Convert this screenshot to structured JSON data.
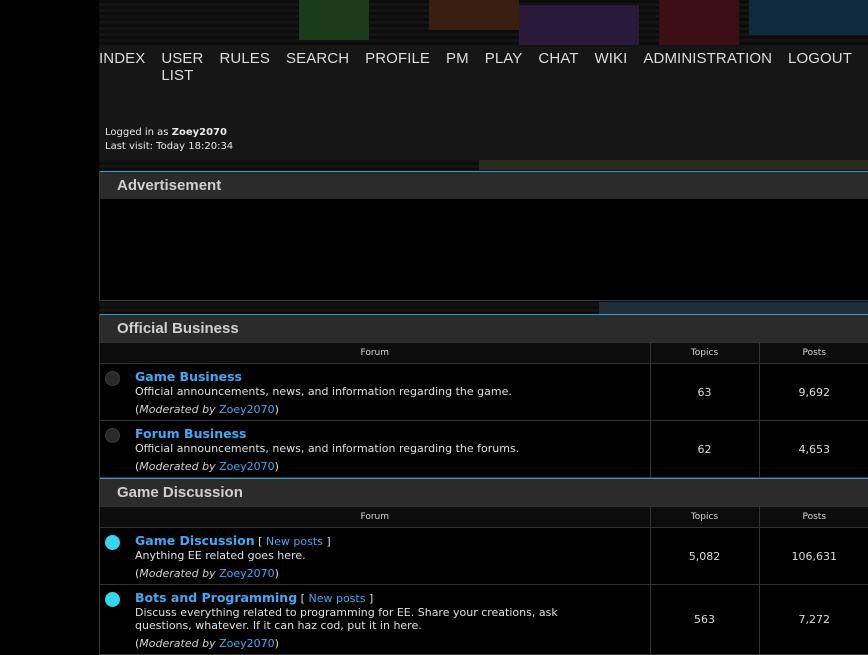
{
  "nav": {
    "items": [
      "INDEX",
      "USER LIST",
      "RULES",
      "SEARCH",
      "PROFILE",
      "PM",
      "PLAY",
      "CHAT",
      "WIKI",
      "ADMINISTRATION",
      "LOGOUT"
    ]
  },
  "login": {
    "prefix": "Logged in as ",
    "username": "Zoey2070",
    "last_visit": "Last visit: Today 18:20:34"
  },
  "advertisement": {
    "title": "Advertisement"
  },
  "columns": {
    "forum": "Forum",
    "topics": "Topics",
    "posts": "Posts"
  },
  "sections": [
    {
      "title": "Official Business",
      "forums": [
        {
          "name": "Game Business",
          "new": false,
          "desc": "Official announcements, news, and information regarding the game.",
          "moderated_label": "Moderated by",
          "moderator": "Zoey2070",
          "topics": "63",
          "posts": "9,692"
        },
        {
          "name": "Forum Business",
          "new": false,
          "desc": "Official announcements, news, and information regarding the forums.",
          "moderated_label": "Moderated by",
          "moderator": "Zoey2070",
          "topics": "62",
          "posts": "4,653"
        }
      ]
    },
    {
      "title": "Game Discussion",
      "forums": [
        {
          "name": "Game Discussion",
          "new": true,
          "new_label": "New posts",
          "desc": "Anything EE related goes here.",
          "moderated_label": "Moderated by",
          "moderator": "Zoey2070",
          "topics": "5,082",
          "posts": "106,631"
        },
        {
          "name": "Bots and Programming",
          "new": true,
          "new_label": "New posts",
          "desc": "Discuss everything related to programming for EE. Share your creations, ask questions, whatever. If it can haz cod, put it in here.",
          "moderated_label": "Moderated by",
          "moderator": "Zoey2070",
          "topics": "563",
          "posts": "7,272"
        }
      ]
    }
  ],
  "colors": {
    "accent": "#3fa9f5",
    "new_indicator": "#35d6f0",
    "header_border": "#2f9fd8"
  }
}
